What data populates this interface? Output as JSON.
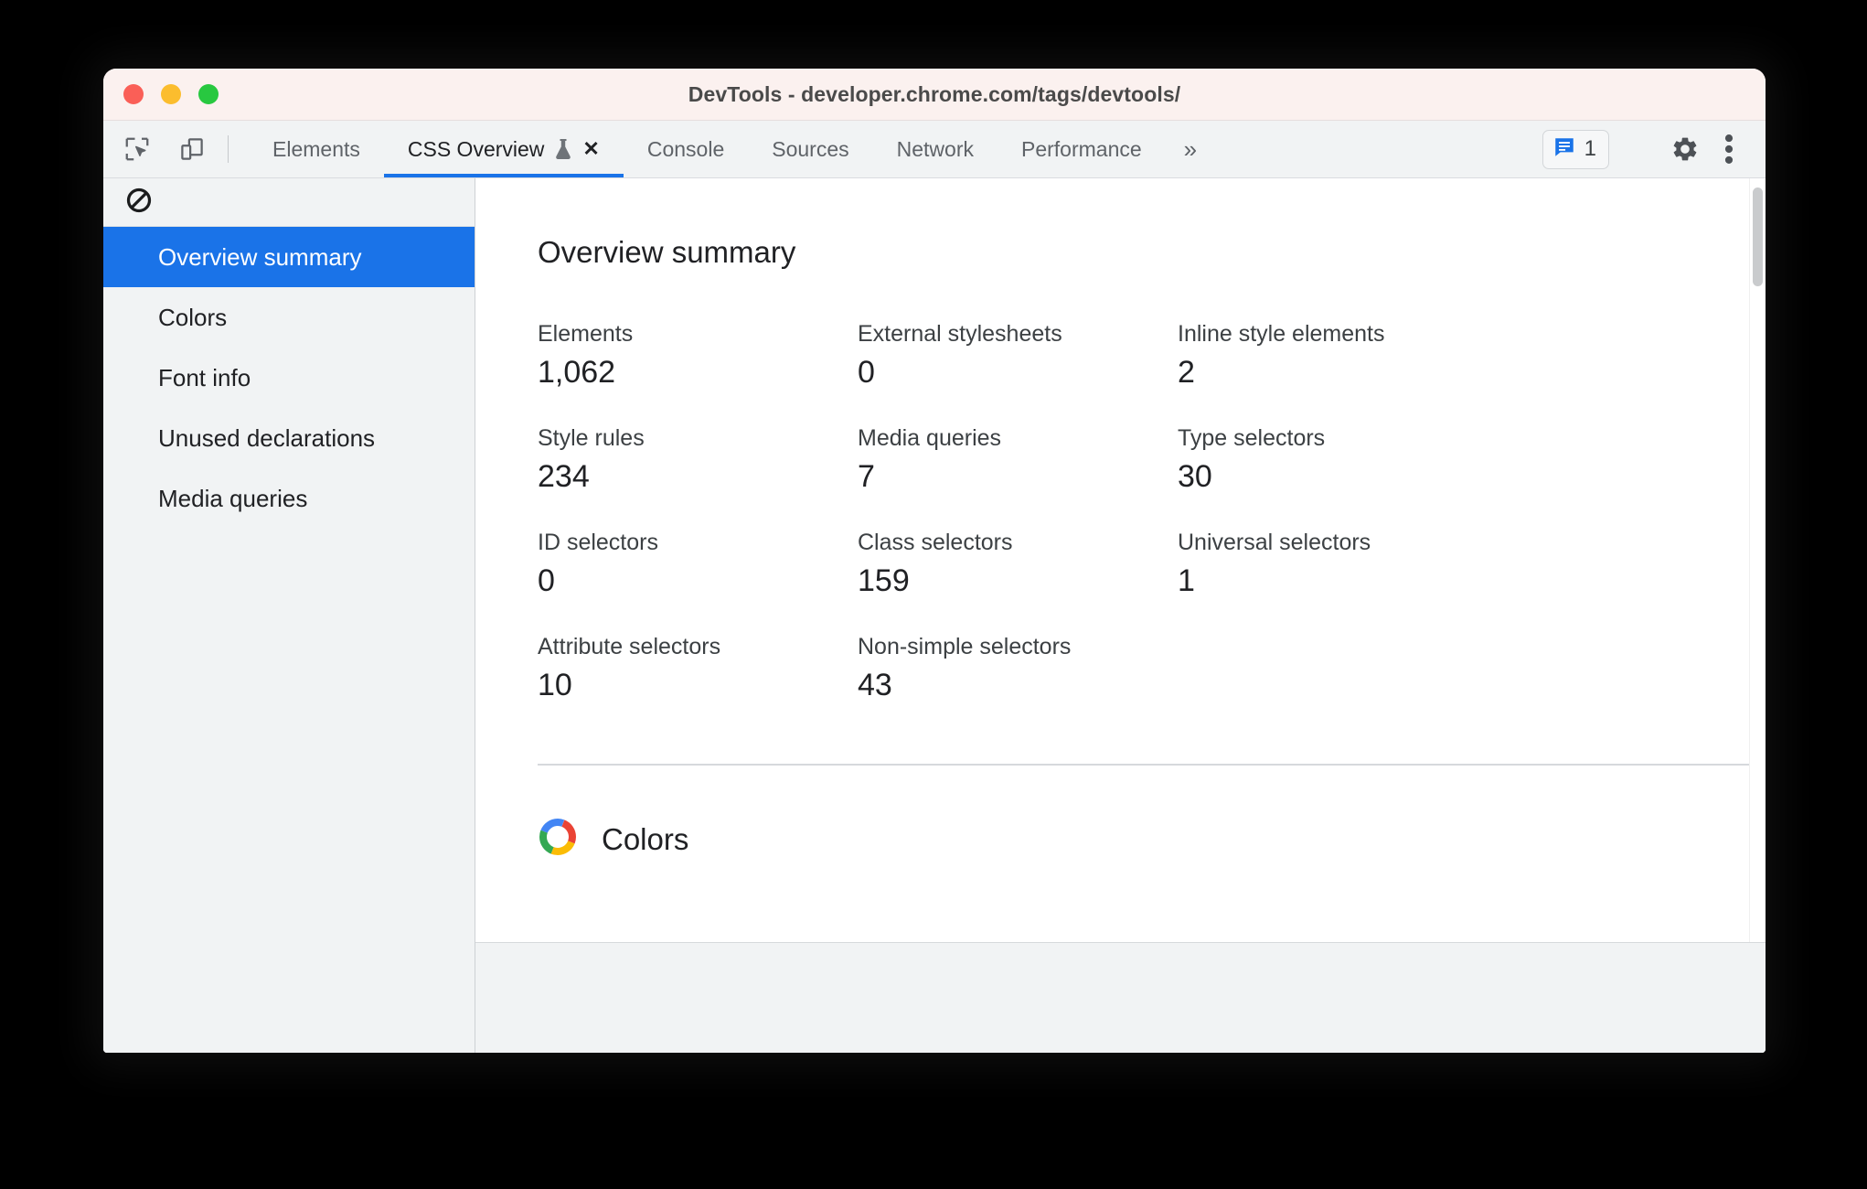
{
  "window": {
    "title": "DevTools - developer.chrome.com/tags/devtools/",
    "traffic_lights": [
      "close",
      "minimize",
      "maximize"
    ]
  },
  "toolbar": {
    "left_icons": [
      {
        "name": "inspect-element-icon",
        "label": "Inspect element"
      },
      {
        "name": "device-toolbar-icon",
        "label": "Toggle device toolbar"
      }
    ],
    "tabs": [
      {
        "label": "Elements",
        "active": false,
        "closable": false,
        "experimental": false
      },
      {
        "label": "CSS Overview",
        "active": true,
        "closable": true,
        "experimental": true
      },
      {
        "label": "Console",
        "active": false,
        "closable": false,
        "experimental": false
      },
      {
        "label": "Sources",
        "active": false,
        "closable": false,
        "experimental": false
      },
      {
        "label": "Network",
        "active": false,
        "closable": false,
        "experimental": false
      },
      {
        "label": "Performance",
        "active": false,
        "closable": false,
        "experimental": false
      }
    ],
    "overflow_label": "»",
    "close_glyph": "✕",
    "console_badge": {
      "icon": "message-icon",
      "count": "1"
    },
    "settings_icon": "gear-icon",
    "more_icon": "kebab-menu-icon",
    "accent_color": "#1a73e8"
  },
  "sidebar": {
    "clear_icon": "clear-overview-icon",
    "items": [
      {
        "label": "Overview summary",
        "selected": true
      },
      {
        "label": "Colors",
        "selected": false
      },
      {
        "label": "Font info",
        "selected": false
      },
      {
        "label": "Unused declarations",
        "selected": false
      },
      {
        "label": "Media queries",
        "selected": false
      }
    ]
  },
  "main": {
    "summary": {
      "title": "Overview summary",
      "stats": [
        {
          "label": "Elements",
          "value": "1,062"
        },
        {
          "label": "External stylesheets",
          "value": "0"
        },
        {
          "label": "Inline style elements",
          "value": "2"
        },
        {
          "label": "Style rules",
          "value": "234"
        },
        {
          "label": "Media queries",
          "value": "7"
        },
        {
          "label": "Type selectors",
          "value": "30"
        },
        {
          "label": "ID selectors",
          "value": "0"
        },
        {
          "label": "Class selectors",
          "value": "159"
        },
        {
          "label": "Universal selectors",
          "value": "1"
        },
        {
          "label": "Attribute selectors",
          "value": "10"
        },
        {
          "label": "Non-simple selectors",
          "value": "43"
        },
        {
          "label": "",
          "value": ""
        }
      ]
    },
    "colors_section": {
      "title": "Colors",
      "icon": "color-wheel-icon",
      "wheel_colors": [
        "#ea4335",
        "#fbbc05",
        "#34a853",
        "#4285f4"
      ]
    }
  }
}
